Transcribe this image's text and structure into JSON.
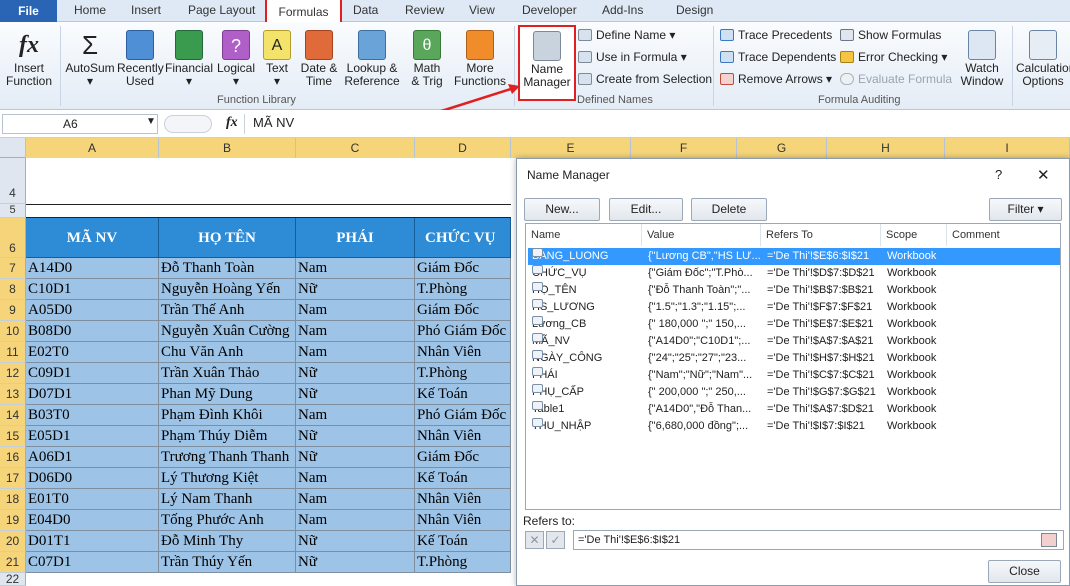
{
  "tabs": {
    "file": "File",
    "home": "Home",
    "insert": "Insert",
    "page_layout": "Page Layout",
    "formulas": "Formulas",
    "data": "Data",
    "review": "Review",
    "view": "View",
    "developer": "Developer",
    "addins": "Add-Ins",
    "design": "Design"
  },
  "ribbon": {
    "insert_function": [
      "Insert",
      "Function"
    ],
    "autosum": "AutoSum",
    "recently_used": [
      "Recently",
      "Used"
    ],
    "financial": "Financial",
    "logical": "Logical",
    "text": "Text",
    "date_time": [
      "Date &",
      "Time"
    ],
    "lookup": [
      "Lookup &",
      "Reference"
    ],
    "math": [
      "Math",
      "& Trig"
    ],
    "more": [
      "More",
      "Functions"
    ],
    "function_library": "Function Library",
    "name_manager": [
      "Name",
      "Manager"
    ],
    "define_name": "Define Name",
    "use_in_formula": "Use in Formula",
    "create_from_selection": "Create from Selection",
    "defined_names": "Defined Names",
    "trace_precedents": "Trace Precedents",
    "trace_dependents": "Trace Dependents",
    "remove_arrows": "Remove Arrows",
    "show_formulas": "Show Formulas",
    "error_checking": "Error Checking",
    "evaluate_formula": "Evaluate Formula",
    "watch_window": [
      "Watch",
      "Window"
    ],
    "formula_auditing": "Formula Auditing",
    "calc_options": [
      "Calculation",
      "Options"
    ]
  },
  "formula_bar": {
    "name_box": "A6",
    "fx": "fx",
    "content": "MÃ NV"
  },
  "columns": [
    "A",
    "B",
    "C",
    "D",
    "E",
    "F",
    "G",
    "H",
    "I"
  ],
  "rows": [
    "4",
    "5",
    "6",
    "7",
    "8",
    "9",
    "10",
    "11",
    "12",
    "13",
    "14",
    "15",
    "16",
    "17",
    "18",
    "19",
    "20",
    "21",
    "22"
  ],
  "table": {
    "headers": [
      "MÃ NV",
      "HỌ TÊN",
      "PHÁI",
      "CHỨC VỤ"
    ],
    "data": [
      [
        "A14D0",
        "Đỗ Thanh Toàn",
        "Nam",
        "Giám Đốc"
      ],
      [
        "C10D1",
        "Nguyễn Hoàng Yến",
        "Nữ",
        "T.Phòng"
      ],
      [
        "A05D0",
        "Trần Thế Anh",
        "Nam",
        "Giám Đốc"
      ],
      [
        "B08D0",
        "Nguyễn Xuân Cường",
        "Nam",
        "Phó Giám Đốc"
      ],
      [
        "E02T0",
        "Chu Văn Anh",
        "Nam",
        "Nhân Viên"
      ],
      [
        "C09D1",
        "Trần Xuân Thảo",
        "Nữ",
        "T.Phòng"
      ],
      [
        "D07D1",
        "Phan Mỹ Dung",
        "Nữ",
        "Kế Toán"
      ],
      [
        "B03T0",
        "Phạm Đình Khôi",
        "Nam",
        "Phó Giám Đốc"
      ],
      [
        "E05D1",
        "Phạm Thúy Diễm",
        "Nữ",
        "Nhân Viên"
      ],
      [
        "A06D1",
        "Trương Thanh Thanh",
        "Nữ",
        "Giám Đốc"
      ],
      [
        "D06D0",
        "Lý Thương Kiệt",
        "Nam",
        "Kế Toán"
      ],
      [
        "E01T0",
        "Lý Nam Thanh",
        "Nam",
        "Nhân Viên"
      ],
      [
        "E04D0",
        "Tống Phước Anh",
        "Nam",
        "Nhân Viên"
      ],
      [
        "D01T1",
        "Đỗ Minh Thy",
        "Nữ",
        "Kế Toán"
      ],
      [
        "C07D1",
        "Trần Thúy Yến",
        "Nữ",
        "T.Phòng"
      ]
    ]
  },
  "dialog": {
    "title": "Name Manager",
    "help": "?",
    "close": "✕",
    "new": "New...",
    "edit": "Edit...",
    "delete": "Delete",
    "filter": "Filter ▾",
    "headers": [
      "Name",
      "Value",
      "Refers To",
      "Scope",
      "Comment"
    ],
    "names": [
      [
        "BANG_LUONG",
        "{\"Lương CB\",\"HS LƯ...",
        "='De Thi'!$E$6:$I$21",
        "Workbook"
      ],
      [
        "CHỨC_VỤ",
        "{\"Giám Đốc\";\"T.Phò...",
        "='De Thi'!$D$7:$D$21",
        "Workbook"
      ],
      [
        "HỌ_TÊN",
        "{\"Đỗ Thanh Toàn\";\"...",
        "='De Thi'!$B$7:$B$21",
        "Workbook"
      ],
      [
        "HS_LƯƠNG",
        "{\"1.5\";\"1.3\";\"1.15\";...",
        "='De Thi'!$F$7:$F$21",
        "Workbook"
      ],
      [
        "Lương_CB",
        "{\" 180,000 \";\" 150,...",
        "='De Thi'!$E$7:$E$21",
        "Workbook"
      ],
      [
        "MÃ_NV",
        "{\"A14D0\";\"C10D1\";...",
        "='De Thi'!$A$7:$A$21",
        "Workbook"
      ],
      [
        "NGÀY_CÔNG",
        "{\"24\";\"25\";\"27\";\"23...",
        "='De Thi'!$H$7:$H$21",
        "Workbook"
      ],
      [
        "PHÁI",
        "{\"Nam\";\"Nữ\";\"Nam\"...",
        "='De Thi'!$C$7:$C$21",
        "Workbook"
      ],
      [
        "PHỤ_CẤP",
        "{\" 200,000 \";\" 250,...",
        "='De Thi'!$G$7:$G$21",
        "Workbook"
      ],
      [
        "Table1",
        "{\"A14D0\",\"Đỗ Than...",
        "='De Thi'!$A$7:$D$21",
        "Workbook"
      ],
      [
        "THU_NHẬP",
        "{\"6,680,000 đồng\";...",
        "='De Thi'!$I$7:$I$21",
        "Workbook"
      ]
    ],
    "refers_to_label": "Refers to:",
    "refers_to_value": "='De Thi'!$E$6:$I$21",
    "close_btn": "Close"
  }
}
